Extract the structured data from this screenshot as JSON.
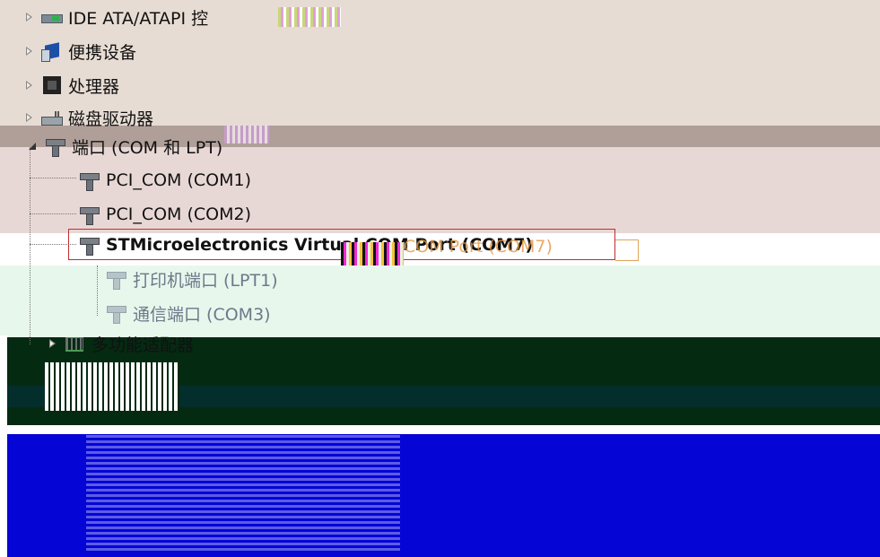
{
  "device_tree": {
    "nodes": [
      {
        "id": "ide",
        "label": "IDE ATA/ATAPI 控",
        "icon": "ide-controller-icon",
        "expanded": false
      },
      {
        "id": "portable",
        "label": "便携设备",
        "icon": "portable-device-icon",
        "expanded": false
      },
      {
        "id": "processor",
        "label": "处理器",
        "icon": "processor-icon",
        "expanded": false
      },
      {
        "id": "disk",
        "label": "磁盘驱动器",
        "icon": "disk-drive-icon",
        "expanded": false
      },
      {
        "id": "ports",
        "label": "端口 (COM 和 LPT)",
        "icon": "port-icon",
        "expanded": true
      },
      {
        "id": "pci_com1",
        "label": "PCI_COM (COM1)",
        "icon": "port-icon"
      },
      {
        "id": "pci_com2",
        "label": "PCI_COM (COM2)",
        "icon": "port-icon"
      },
      {
        "id": "stm",
        "label": "STMicroelectronics Virtual COM Port (COM7)",
        "icon": "port-icon",
        "selected": true
      },
      {
        "id": "lpt1",
        "label": "打印机端口 (LPT1)",
        "icon": "port-icon"
      },
      {
        "id": "com3",
        "label": "通信端口 (COM3)",
        "icon": "port-icon"
      },
      {
        "id": "multi",
        "label": "多功能适配器",
        "icon": "multifunction-adapter-icon",
        "expanded": false
      }
    ],
    "ghost_label": "COM Port (COM7)"
  },
  "colors": {
    "selection_border": "#c32c2c",
    "band_tan": "#e7dcd3",
    "band_dark": "#052a12",
    "band_blue": "#0505d6"
  }
}
